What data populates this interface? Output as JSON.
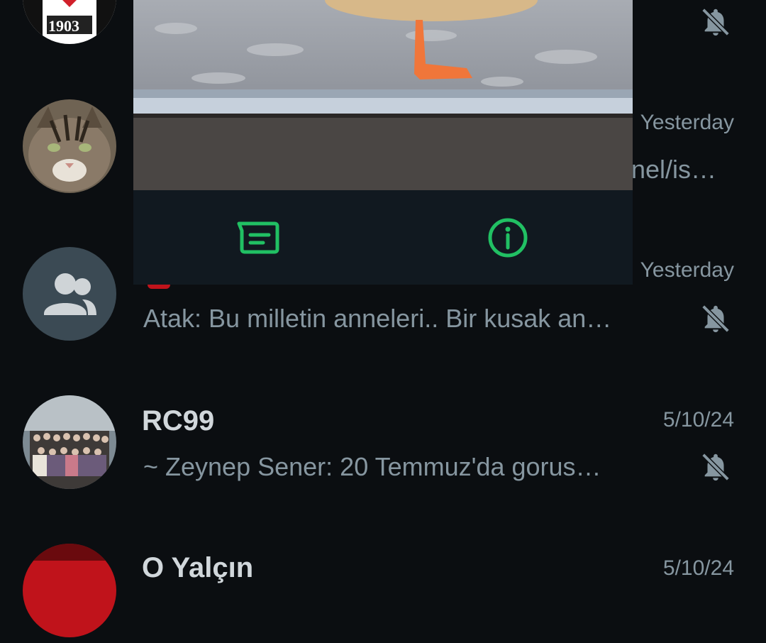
{
  "colors": {
    "background": "#0b0e11",
    "accent_green": "#21c063",
    "muted_text": "#8696a0"
  },
  "chats": [
    {
      "name": "",
      "preview": "",
      "time": "",
      "muted": true,
      "avatar": "besiktas-1903-logo"
    },
    {
      "name": "",
      "preview": "nel/is…",
      "time": "Yesterday",
      "muted": false,
      "avatar": "cat-photo"
    },
    {
      "name": "",
      "preview": "Atak: Bu milletin anneleri.. Bir kusak an…",
      "time": "Yesterday",
      "muted": true,
      "avatar": "group-default"
    },
    {
      "name": "RC99",
      "preview": "~ Zeynep Sener: 20 Temmuz'da gorus…",
      "time": "5/10/24",
      "muted": true,
      "avatar": "group-photo"
    },
    {
      "name": "O Yalçın",
      "preview": "",
      "time": "5/10/24",
      "muted": false,
      "avatar": "red-flag"
    }
  ],
  "avatar_text": {
    "besiktas_year": "1903"
  },
  "popup": {
    "actions": [
      {
        "icon": "message-icon"
      },
      {
        "icon": "info-icon"
      }
    ]
  }
}
